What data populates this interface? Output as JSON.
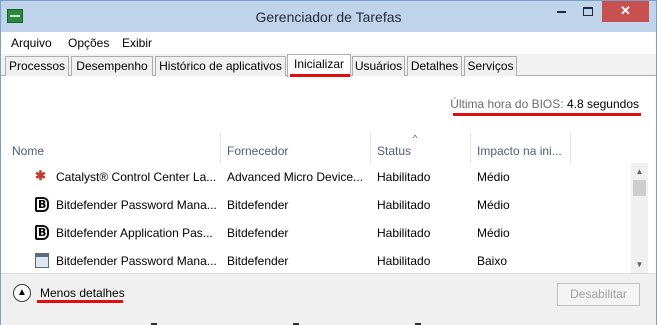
{
  "window": {
    "title": "Gerenciador de Tarefas",
    "close_glyph": "✕"
  },
  "menu": [
    {
      "label": "Arquivo"
    },
    {
      "label": "Opções"
    },
    {
      "label": "Exibir"
    }
  ],
  "tabs": [
    {
      "label": "Processos"
    },
    {
      "label": "Desempenho"
    },
    {
      "label": "Histórico de aplicativos"
    },
    {
      "label": "Inicializar",
      "active": true
    },
    {
      "label": "Usuários"
    },
    {
      "label": "Detalhes"
    },
    {
      "label": "Serviços"
    }
  ],
  "bios": {
    "label": "Última hora do BIOS:",
    "value": "4.8 segundos"
  },
  "columns": [
    {
      "label": "Nome"
    },
    {
      "label": "Fornecedor"
    },
    {
      "label": "Status",
      "sorted": true
    },
    {
      "label": "Impacto na ini..."
    }
  ],
  "sort_glyph": "^",
  "rows": [
    {
      "icon": "catalyst-icon",
      "name": "Catalyst® Control Center La...",
      "vendor": "Advanced Micro Device...",
      "status": "Habilitado",
      "impact": "Médio"
    },
    {
      "icon": "bitdefender-icon",
      "name": "Bitdefender Password Mana...",
      "vendor": "Bitdefender",
      "status": "Habilitado",
      "impact": "Médio"
    },
    {
      "icon": "bitdefender-icon",
      "name": "Bitdefender Application Pas...",
      "vendor": "Bitdefender",
      "status": "Habilitado",
      "impact": "Médio"
    },
    {
      "icon": "window-app-icon",
      "name": "Bitdefender Password Mana...",
      "vendor": "Bitdefender",
      "status": "Habilitado",
      "impact": "Baixo"
    }
  ],
  "scrollbar": {
    "up_glyph": "▲",
    "down_glyph": "▼"
  },
  "footer": {
    "less_details": "Menos detalhes",
    "toggle_glyph": "▲",
    "disable_button": "Desabilitar"
  },
  "colors": {
    "highlight": "#e10e0e",
    "titlebar": "#bfd3ea",
    "close_button": "#c75050"
  }
}
